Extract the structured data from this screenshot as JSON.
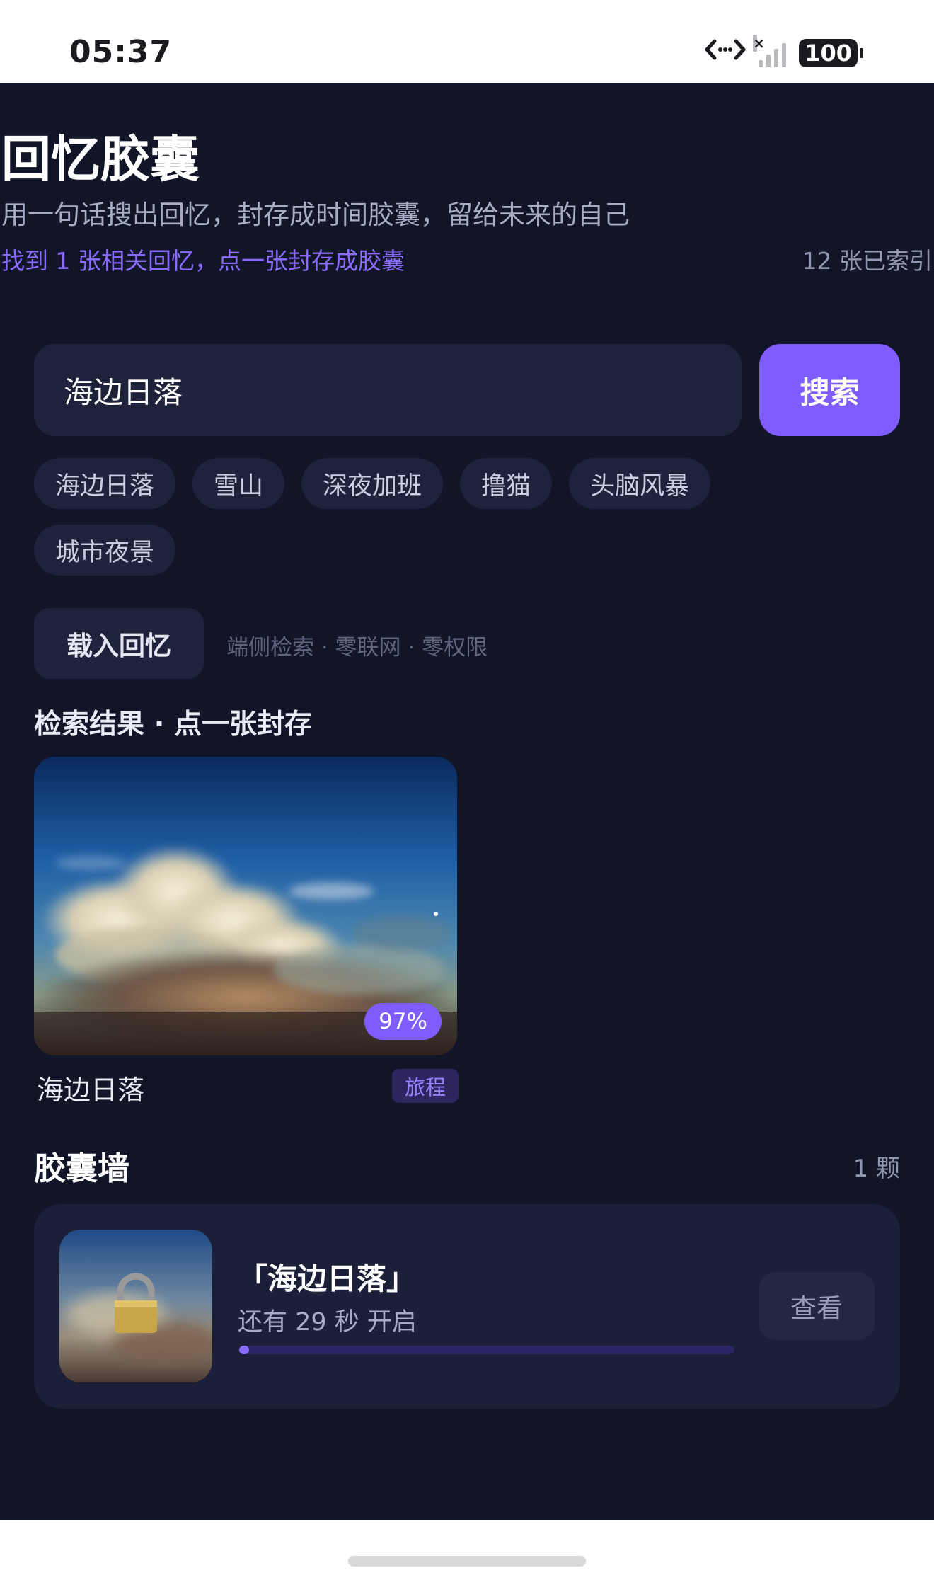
{
  "status_bar": {
    "time": "05:37",
    "icons": [
      "data-transfer-icon",
      "signal-icon",
      "battery-icon"
    ],
    "signal_no_service_mark": "×",
    "battery_level": "100"
  },
  "header": {
    "title": "回忆胶囊",
    "subtitle": "用一句话搜出回忆，封存成时间胶囊，留给未来的自己",
    "found_text": "找到 1 张相关回忆，点一张封存成胶囊",
    "indexed_text": "12 张已索引"
  },
  "search": {
    "value": "海边日落",
    "button_label": "搜索"
  },
  "chips": [
    "海边日落",
    "雪山",
    "深夜加班",
    "撸猫",
    "头脑风暴",
    "城市夜景"
  ],
  "load": {
    "button_label": "载入回忆",
    "note": "端侧检索 · 零联网 · 零权限"
  },
  "results": {
    "heading": "检索结果 · 点一张封存",
    "items": [
      {
        "label": "海边日落",
        "score": "97%",
        "tag": "旅程",
        "image": "sunset-cloud-photo"
      }
    ]
  },
  "wall": {
    "heading": "胶囊墙",
    "count": "1 颗",
    "capsules": [
      {
        "title": "「海边日落」",
        "countdown": "还有 29 秒 开启",
        "progress": 0.02,
        "view_label": "查看",
        "icon": "lock-icon"
      }
    ]
  },
  "colors": {
    "background": "#121527",
    "surface": "#1e223a",
    "accent": "#7f5cff",
    "accent_text": "#8a6bff",
    "muted_text": "#a7acc4"
  }
}
